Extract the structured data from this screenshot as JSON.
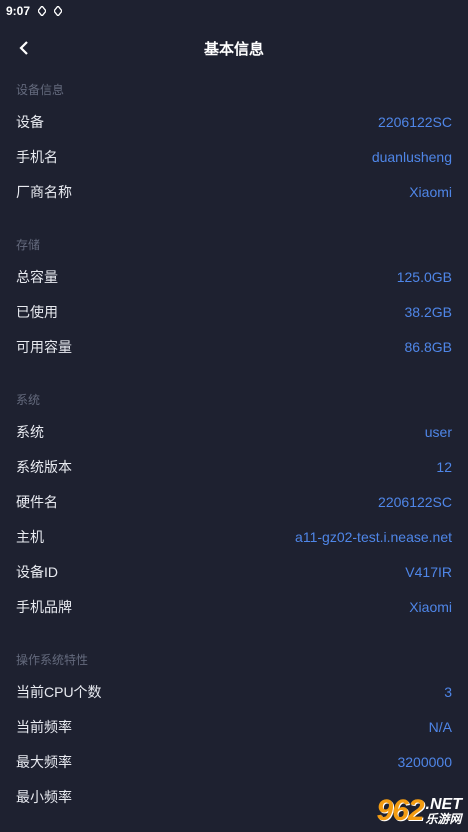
{
  "status_bar": {
    "time": "9:07"
  },
  "header": {
    "title": "基本信息"
  },
  "sections": [
    {
      "title": "设备信息",
      "rows": [
        {
          "label": "设备",
          "value": "2206122SC"
        },
        {
          "label": "手机名",
          "value": "duanlusheng"
        },
        {
          "label": "厂商名称",
          "value": "Xiaomi"
        }
      ]
    },
    {
      "title": "存储",
      "rows": [
        {
          "label": "总容量",
          "value": "125.0GB"
        },
        {
          "label": "已使用",
          "value": "38.2GB"
        },
        {
          "label": "可用容量",
          "value": "86.8GB"
        }
      ]
    },
    {
      "title": "系统",
      "rows": [
        {
          "label": "系统",
          "value": "user"
        },
        {
          "label": "系统版本",
          "value": "12"
        },
        {
          "label": "硬件名",
          "value": "2206122SC"
        },
        {
          "label": "主机",
          "value": "a11-gz02-test.i.nease.net"
        },
        {
          "label": "设备ID",
          "value": "V417IR"
        },
        {
          "label": "手机品牌",
          "value": "Xiaomi"
        }
      ]
    },
    {
      "title": "操作系统特性",
      "rows": [
        {
          "label": "当前CPU个数",
          "value": "3"
        },
        {
          "label": "当前频率",
          "value": "N/A"
        },
        {
          "label": "最大频率",
          "value": "3200000"
        },
        {
          "label": "最小频率",
          "value": ""
        }
      ]
    }
  ],
  "watermark": {
    "main": "962",
    "net": ".NET",
    "sub": "乐游网"
  },
  "colors": {
    "background": "#1e2130",
    "value": "#4f86e8",
    "section_title": "#646a7d"
  }
}
